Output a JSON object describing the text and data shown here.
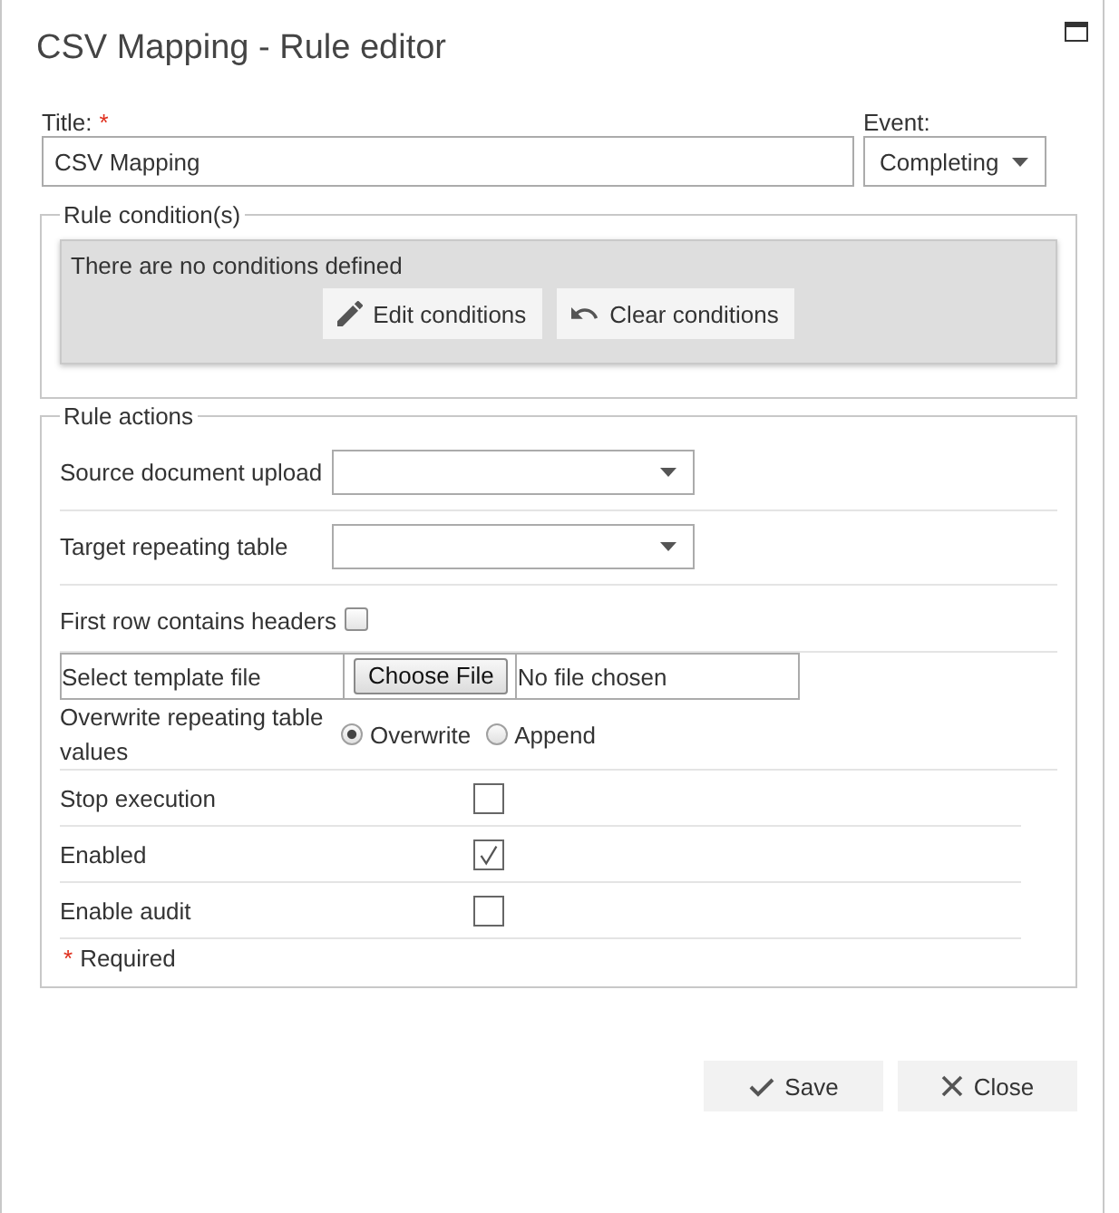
{
  "window": {
    "title": "CSV Mapping - Rule editor"
  },
  "title_field": {
    "label": "Title:",
    "required_mark": "*",
    "value": "CSV Mapping"
  },
  "event_field": {
    "label": "Event:",
    "value": "Completing"
  },
  "conditions": {
    "legend": "Rule condition(s)",
    "message": "There are no conditions defined",
    "buttons": [
      {
        "kind": "edit",
        "label": "Edit conditions"
      },
      {
        "kind": "clear",
        "label": "Clear conditions"
      }
    ]
  },
  "actions": {
    "legend": "Rule actions",
    "rows": [
      {
        "kind": "dropdown",
        "label": "Source document upload"
      },
      {
        "kind": "dropdown",
        "label": "Target repeating table"
      },
      {
        "kind": "flag",
        "label": "First row contains headers",
        "checked": false
      },
      {
        "kind": "file",
        "label": "Select template file",
        "button": "Choose File",
        "status": "No file chosen"
      },
      {
        "kind": "choice",
        "label": "Overwrite repeating table values",
        "options": [
          {
            "label": "Overwrite",
            "selected": true
          },
          {
            "label": "Append",
            "selected": false
          }
        ]
      },
      {
        "kind": "checkbox",
        "label": "Stop execution",
        "checked": false
      },
      {
        "kind": "checkbox",
        "label": "Enabled",
        "checked": true
      },
      {
        "kind": "checkbox",
        "label": "Enable audit",
        "checked": false
      }
    ],
    "required_note": {
      "mark": "*",
      "text": "Required"
    }
  },
  "buttons": [
    {
      "kind": "save",
      "label": "Save"
    },
    {
      "kind": "close",
      "label": "Close"
    }
  ]
}
